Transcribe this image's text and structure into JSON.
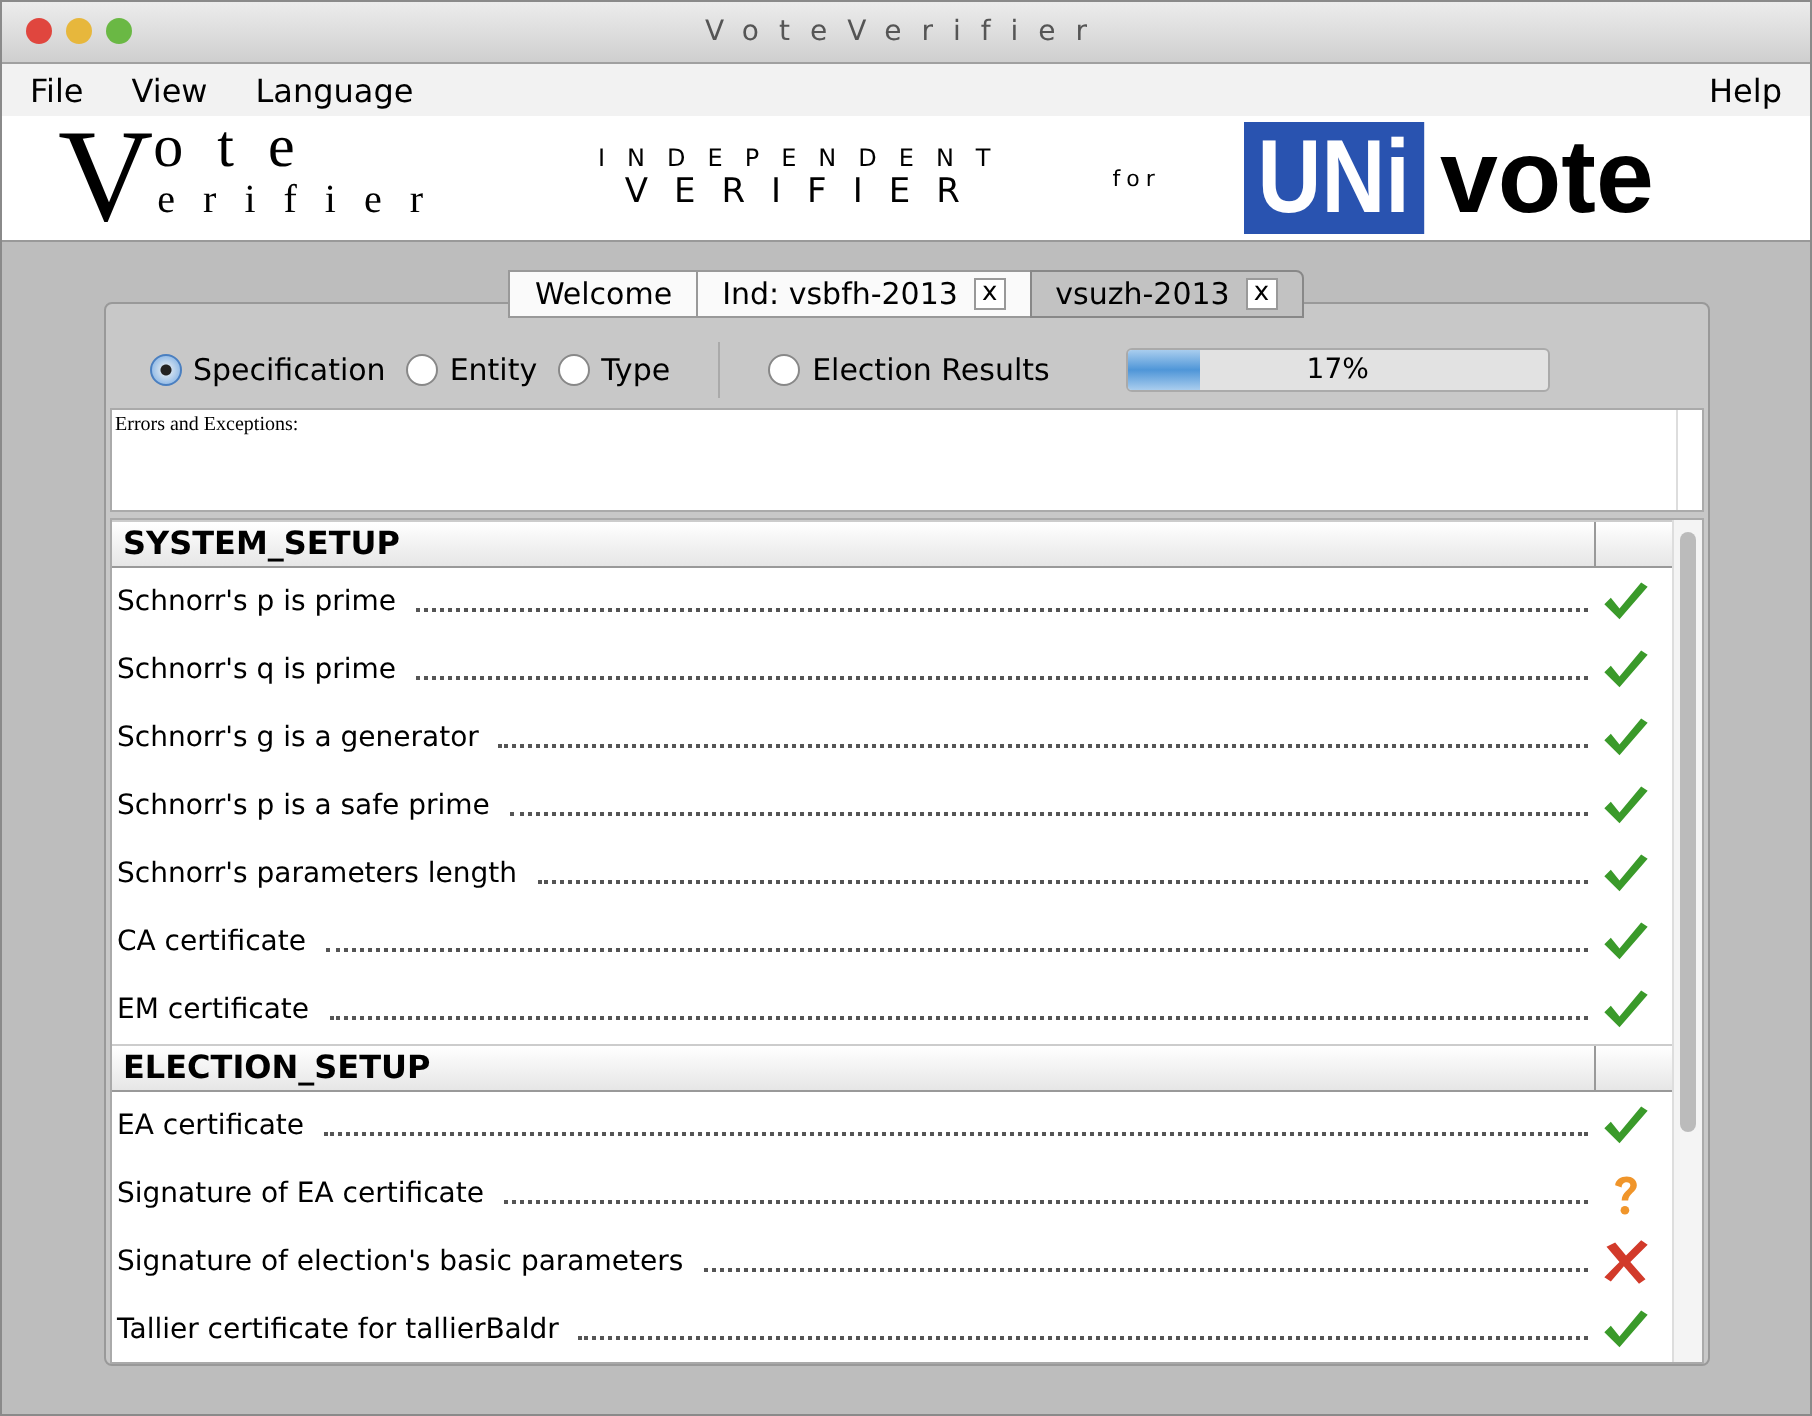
{
  "window": {
    "title": "VoteVerifier"
  },
  "menu": {
    "left": [
      "File",
      "View",
      "Language"
    ],
    "right": [
      "Help"
    ]
  },
  "banner": {
    "logo_initial": "V",
    "logo_top": "ote",
    "logo_bottom": "erifier",
    "tagline_top": "INDEPENDENT",
    "tagline_bottom": "VERIFIER",
    "connector": "for",
    "partner_left": "UNi",
    "partner_right": "vote"
  },
  "tabs": [
    {
      "label": "Welcome",
      "selected": false
    },
    {
      "label": "Ind: vsbfh-2013",
      "close": "x",
      "selected": false
    },
    {
      "label": "vsuzh-2013",
      "close": "x",
      "selected": true
    }
  ],
  "views": [
    {
      "label": "Specification",
      "selected": true
    },
    {
      "label": "Entity",
      "selected": false
    },
    {
      "label": "Type",
      "selected": false
    },
    {
      "label": "Election Results",
      "selected": false
    }
  ],
  "progress": {
    "level": 0.17,
    "reading": "17%"
  },
  "errors": {
    "label": "Errors and Exceptions:"
  },
  "sections": [
    {
      "title": "SYSTEM_SETUP",
      "rows": [
        {
          "label": "Schnorr's p is prime",
          "kind": "pass"
        },
        {
          "label": "Schnorr's q is prime",
          "kind": "pass"
        },
        {
          "label": "Schnorr's g is a generator",
          "kind": "pass"
        },
        {
          "label": "Schnorr's p is a safe prime",
          "kind": "pass"
        },
        {
          "label": "Schnorr's parameters length",
          "kind": "pass"
        },
        {
          "label": "CA certificate",
          "kind": "pass"
        },
        {
          "label": "EM certificate",
          "kind": "pass"
        }
      ]
    },
    {
      "title": "ELECTION_SETUP",
      "rows": [
        {
          "label": "EA certificate",
          "kind": "pass"
        },
        {
          "label": "Signature of EA certificate",
          "kind": "unknown"
        },
        {
          "label": "Signature of election's basic parameters",
          "kind": "fail"
        },
        {
          "label": "Tallier certificate for tallierBaldr",
          "kind": "pass"
        }
      ]
    }
  ]
}
